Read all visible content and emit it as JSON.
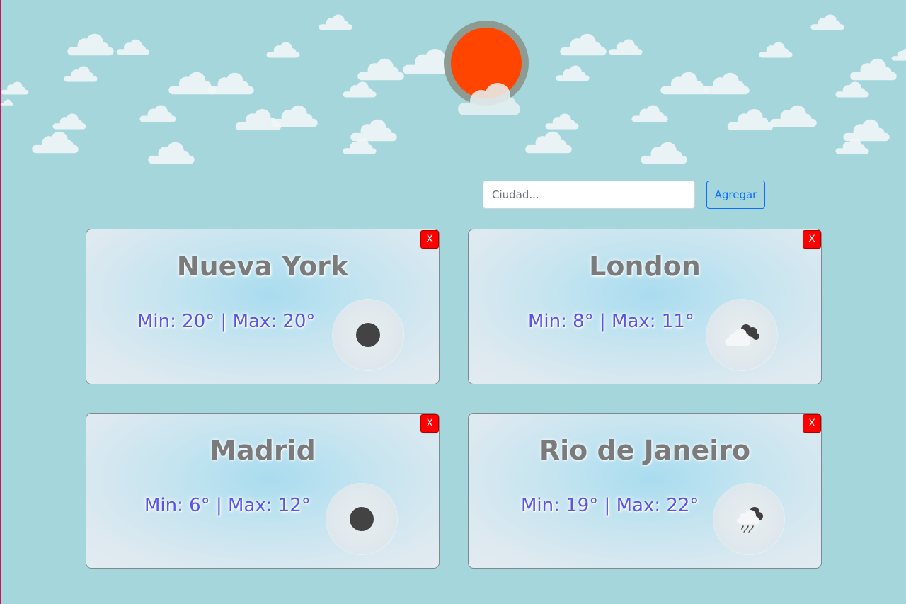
{
  "search": {
    "placeholder": "Ciudad...",
    "value": "",
    "add_label": "Agregar"
  },
  "colors": {
    "background": "#a5d6db",
    "sun": "#ff4500",
    "sun_ring": "#8e9b92",
    "close": "#ff0000",
    "accent": "#0d6efd",
    "temps_text": "#5a55e8"
  },
  "cards": [
    {
      "city": "Nueva York",
      "min_label": "Min:",
      "min": "20°",
      "sep": "|",
      "max_label": "Max:",
      "max": "20°",
      "close": "X",
      "icon": "dark-dot-icon"
    },
    {
      "city": "London",
      "min_label": "Min:",
      "min": "8°",
      "sep": "|",
      "max_label": "Max:",
      "max": "11°",
      "close": "X",
      "icon": "cloudy-icon"
    },
    {
      "city": "Madrid",
      "min_label": "Min:",
      "min": "6°",
      "sep": "|",
      "max_label": "Max:",
      "max": "12°",
      "close": "X",
      "icon": "dark-dot-icon"
    },
    {
      "city": "Rio de Janeiro",
      "min_label": "Min:",
      "min": "19°",
      "sep": "|",
      "max_label": "Max:",
      "max": "22°",
      "close": "X",
      "icon": "rain-cloud-icon"
    }
  ]
}
